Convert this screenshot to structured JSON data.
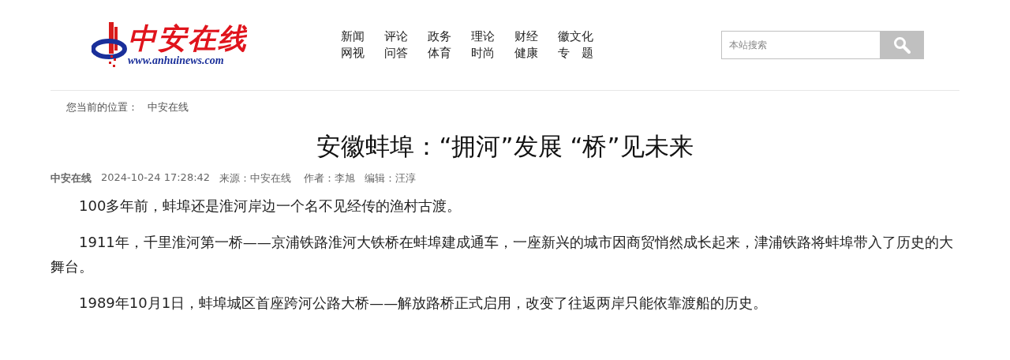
{
  "logo": {
    "name": "中安在线",
    "url": "www.anhuinews.com"
  },
  "nav": [
    [
      "新闻",
      "网视"
    ],
    [
      "评论",
      "问答"
    ],
    [
      "政务",
      "体育"
    ],
    [
      "理论",
      "时尚"
    ],
    [
      "财经",
      "健康"
    ],
    [
      "徽文化",
      "专　题"
    ]
  ],
  "search": {
    "placeholder": "本站搜索"
  },
  "breadcrumb": {
    "label": "您当前的位置：",
    "items": [
      "中安在线"
    ]
  },
  "article": {
    "title": "安徽蚌埠：“拥河”发展 “桥”见未来",
    "meta": {
      "site": "中安在线",
      "date": "2024-10-24 17:28:42",
      "source": "来源：中安在线",
      "author": "作者：李旭",
      "editor": "编辑：汪淳"
    },
    "paragraphs": [
      "100多年前，蚌埠还是淮河岸边一个名不见经传的渔村古渡。",
      "1911年，千里淮河第一桥——京浦铁路淮河大铁桥在蚌埠建成通车，一座新兴的城市因商贸悄然成长起来，津浦铁路将蚌埠带入了历史的大舞台。",
      "1989年10月1日，蚌埠城区首座跨河公路大桥——解放路桥正式启用，改变了往返两岸只能依靠渡船的历史。"
    ]
  }
}
